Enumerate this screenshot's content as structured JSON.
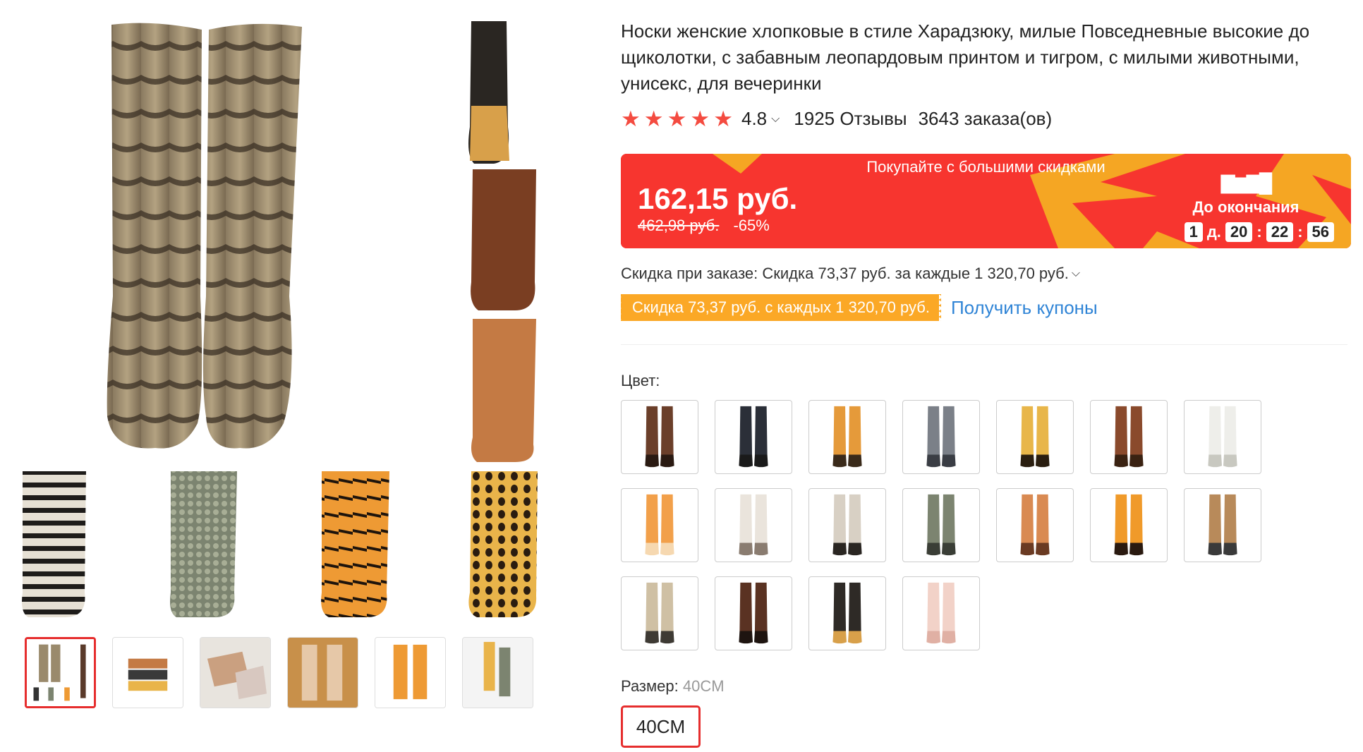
{
  "product": {
    "title": "Носки женские хлопковые в стиле Харадзюку, милые Повседневные высокие до щиколотки, с забавным леопардовым принтом и тигром, с милыми животными, унисекс, для вечеринки",
    "rating": "4.8",
    "stars": 5,
    "reviews": "1925 Отзывы",
    "orders": "3643 заказа(ов)"
  },
  "price": {
    "banner_label": "Покупайте с большими скидками",
    "current": "162,15 руб.",
    "original": "462,98 руб.",
    "discount": "-65%",
    "countdown_title": "До окончания",
    "days": "1",
    "days_label": "д.",
    "hours": "20",
    "minutes": "22",
    "seconds": "56",
    "separator": ":"
  },
  "discount": {
    "text": "Скидка при заказе: Скидка 73,37 руб. за каждые 1 320,70 руб.",
    "coupon_tag": "Скидка 73,37 руб. с каждых 1 320,70 руб.",
    "get_coupons": "Получить купоны"
  },
  "color": {
    "label": "Цвет:",
    "swatches": [
      {
        "name": "brown",
        "colors": [
          "#6b3f2a",
          "#2a1a12"
        ]
      },
      {
        "name": "black",
        "colors": [
          "#2b2f38",
          "#1a1a1a"
        ]
      },
      {
        "name": "orange",
        "colors": [
          "#e59a3a",
          "#3a2a1a"
        ]
      },
      {
        "name": "grey",
        "colors": [
          "#7b8088",
          "#3a3d44"
        ]
      },
      {
        "name": "leopard",
        "colors": [
          "#e8b64a",
          "#2a1e10"
        ]
      },
      {
        "name": "chestnut",
        "colors": [
          "#8a4a2c",
          "#3a2212"
        ]
      },
      {
        "name": "white",
        "colors": [
          "#eeeeea",
          "#c8c8c0"
        ]
      },
      {
        "name": "tiger-paw",
        "colors": [
          "#f2a04a",
          "#f6d8b0"
        ]
      },
      {
        "name": "white-paw",
        "colors": [
          "#eae4dc",
          "#8a7c70"
        ]
      },
      {
        "name": "zebra",
        "colors": [
          "#d8d0c4",
          "#2a2622"
        ]
      },
      {
        "name": "snake",
        "colors": [
          "#7c8470",
          "#3a3e36"
        ]
      },
      {
        "name": "fox",
        "colors": [
          "#d98a52",
          "#6a3a22"
        ]
      },
      {
        "name": "tiger",
        "colors": [
          "#f09a2a",
          "#2a1a10"
        ]
      },
      {
        "name": "horse-hoof",
        "colors": [
          "#b88a5a",
          "#3a3a3a"
        ]
      },
      {
        "name": "giraffe",
        "colors": [
          "#cfc0a4",
          "#3e3a34"
        ]
      },
      {
        "name": "dark-brown",
        "colors": [
          "#5a3222",
          "#1e1410"
        ]
      },
      {
        "name": "eagle",
        "colors": [
          "#2e2a26",
          "#d8a04a"
        ]
      },
      {
        "name": "pink",
        "colors": [
          "#f2d2c8",
          "#e0b0a4"
        ]
      }
    ]
  },
  "size": {
    "label": "Размер:",
    "selected": "40CM",
    "options": [
      "40CM"
    ]
  },
  "colors": {
    "accent": "#f7352f",
    "coupon": "#fba826",
    "link": "#2f84d6",
    "star": "#f44b40"
  }
}
